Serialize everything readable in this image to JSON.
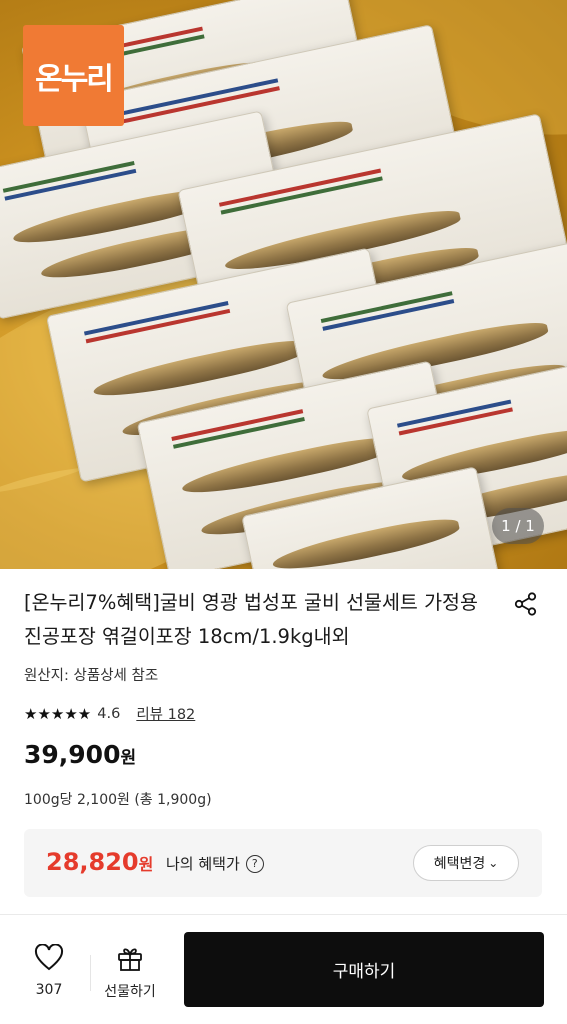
{
  "product_image": {
    "logo_text": "온누리",
    "counter": "1 / 1"
  },
  "product": {
    "title": "[온누리7%혜택]굴비 영광 법성포 굴비 선물세트 가정용 진공포장 엮걸이포장 18cm/1.9kg내외",
    "origin": "원산지: 상품상세 참조",
    "rating_stars": "★★★★★",
    "rating_value": 4.6,
    "rating_score": "4.6",
    "review_label": "리뷰 182",
    "price": "39,900",
    "price_unit": "원",
    "unit_price": "100g당 2,100원 (총 1,900g)"
  },
  "benefit": {
    "price": "28,820",
    "price_unit": "원",
    "label": "나의 혜택가",
    "help_icon": "?",
    "change_button": "혜택변경",
    "chevron": "⌄"
  },
  "bottom_bar": {
    "wish_count": "307",
    "gift_label": "선물하기",
    "buy_label": "구매하기"
  },
  "colors": {
    "logo_bg": "#f07a34",
    "benefit_price": "#e53b2c",
    "buy_button": "#0d0d0d"
  }
}
